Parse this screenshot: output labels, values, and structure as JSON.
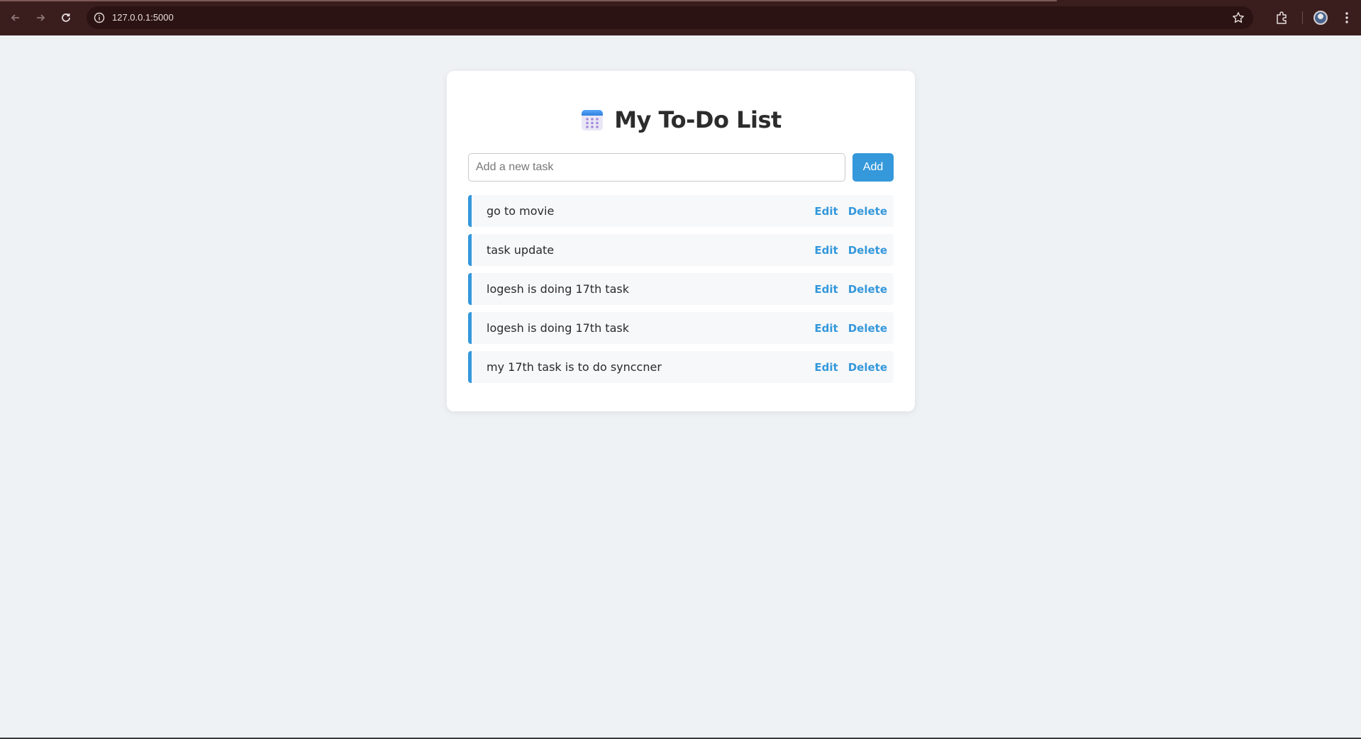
{
  "browser": {
    "url": "127.0.0.1:5000"
  },
  "app": {
    "title": "My To-Do List",
    "title_icon": "calendar-icon",
    "input": {
      "placeholder": "Add a new task",
      "value": ""
    },
    "add_label": "Add",
    "accent_color": "#3498db",
    "tasks": [
      {
        "text": "go to movie",
        "edit_label": "Edit",
        "delete_label": "Delete"
      },
      {
        "text": "task update",
        "edit_label": "Edit",
        "delete_label": "Delete"
      },
      {
        "text": "logesh is doing 17th task",
        "edit_label": "Edit",
        "delete_label": "Delete"
      },
      {
        "text": "logesh is doing 17th task",
        "edit_label": "Edit",
        "delete_label": "Delete"
      },
      {
        "text": "my 17th task is to do synccner",
        "edit_label": "Edit",
        "delete_label": "Delete"
      }
    ]
  }
}
